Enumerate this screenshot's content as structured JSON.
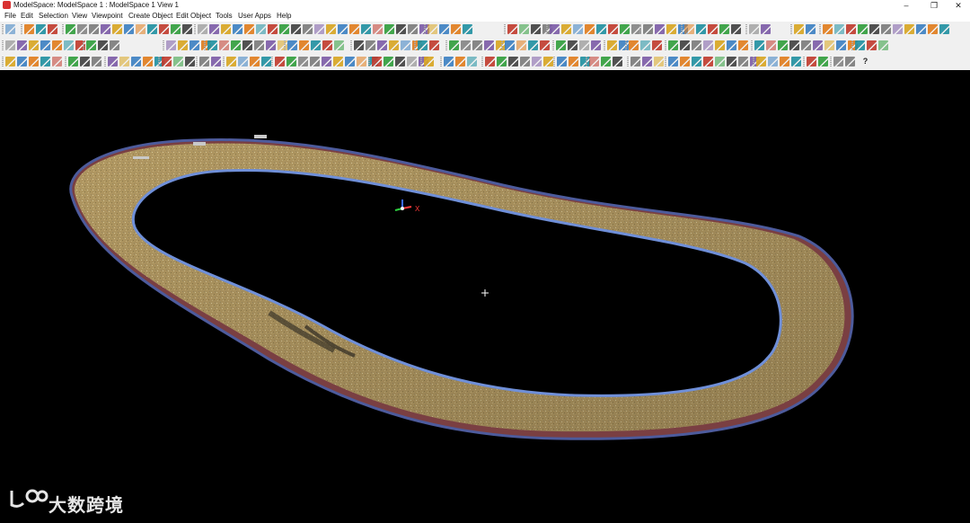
{
  "window": {
    "title": "ModelSpace: ModelSpace 1 : ModelSpace 1 View 1",
    "minimize_label": "–",
    "maximize_label": "❐",
    "close_label": "✕"
  },
  "menu": {
    "items": [
      {
        "label": "File"
      },
      {
        "label": "Edit"
      },
      {
        "label": "Selection"
      },
      {
        "label": "View"
      },
      {
        "label": "Viewpoint"
      },
      {
        "label": "Create Object"
      },
      {
        "label": "Edit Object"
      },
      {
        "label": "Tools"
      },
      {
        "label": "User Apps"
      },
      {
        "label": "Help"
      }
    ]
  },
  "toolbar": {
    "rows": 3,
    "help_label": "?",
    "palette": [
      "#3a7fc1",
      "#2e9d3a",
      "#d8a51f",
      "#c0392b",
      "#7b5aa6",
      "#1e8fa0",
      "#7a7a7a",
      "#e07b1a",
      "#3f3f3f"
    ]
  },
  "viewport": {
    "background": "#000000",
    "axis_label": "X",
    "cursor_icon": "crosshair-icon",
    "track_color": "#b39a62",
    "track_edge_color": "#6f8fd8"
  },
  "watermark": {
    "text": "大数跨境"
  }
}
